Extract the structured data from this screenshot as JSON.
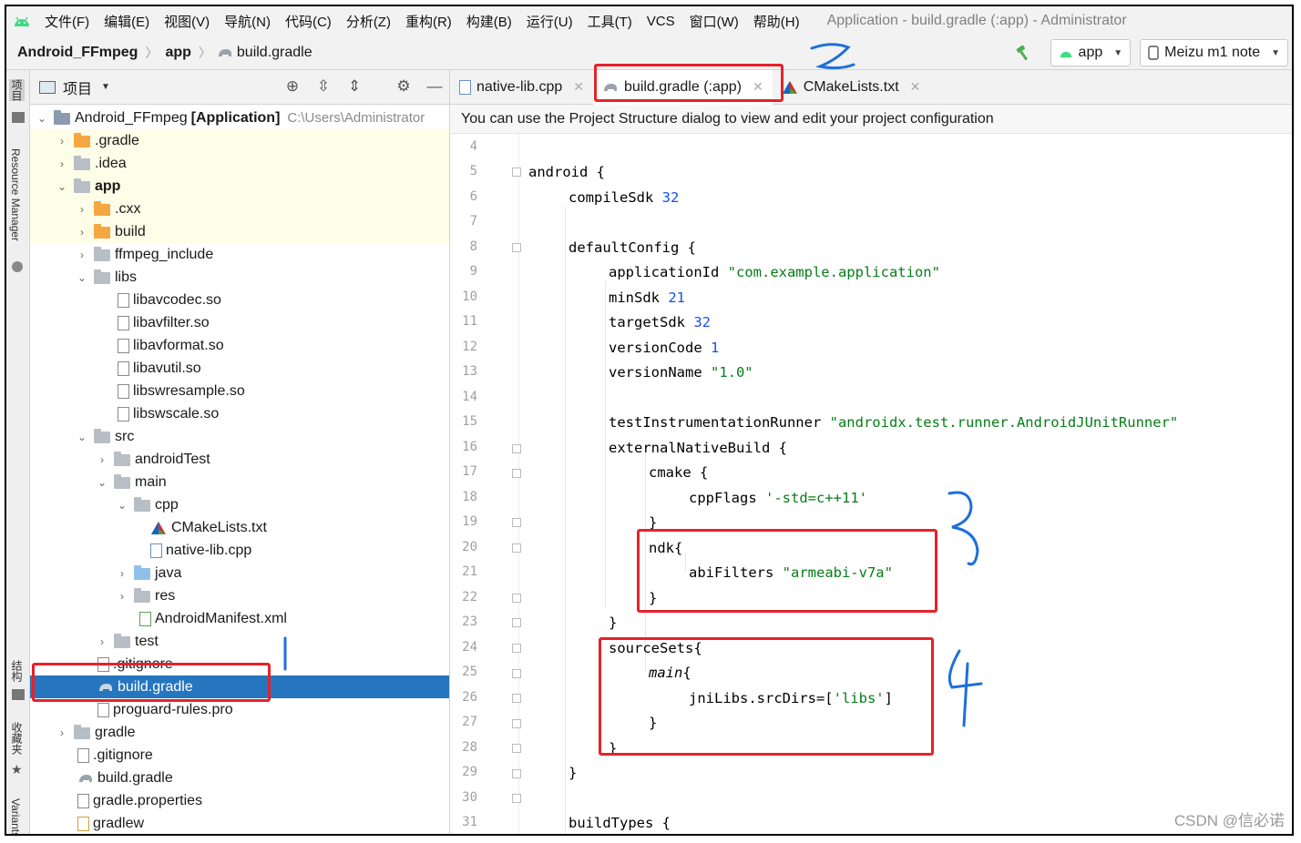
{
  "menu": {
    "items": [
      "文件(F)",
      "编辑(E)",
      "视图(V)",
      "导航(N)",
      "代码(C)",
      "分析(Z)",
      "重构(R)",
      "构建(B)",
      "运行(U)",
      "工具(T)",
      "VCS",
      "窗口(W)",
      "帮助(H)"
    ],
    "window_title": "Application - build.gradle (:app) - Administrator"
  },
  "navbar": {
    "project": "Android_FFmpeg",
    "module": "app",
    "file": "build.gradle",
    "run_config": "app",
    "device": "Meizu m1 note"
  },
  "leftstrip": {
    "project_tab": "项目",
    "resource_manager": "Resource Manager",
    "structure": "结构",
    "favorites": "收藏夹",
    "variants": "Variants"
  },
  "project_panel": {
    "header": "项目",
    "root_name": "Android_FFmpeg",
    "root_tag": "[Application]",
    "root_path": "C:\\Users\\Administrator",
    "items": {
      "gradle_dir": ".gradle",
      "idea": ".idea",
      "app": "app",
      "cxx": ".cxx",
      "build": "build",
      "ffmpeg_include": "ffmpeg_include",
      "libs": "libs",
      "libavcodec": "libavcodec.so",
      "libavfilter": "libavfilter.so",
      "libavformat": "libavformat.so",
      "libavutil": "libavutil.so",
      "libswresample": "libswresample.so",
      "libswscale": "libswscale.so",
      "src": "src",
      "androidTest": "androidTest",
      "main": "main",
      "cpp": "cpp",
      "cmakelists": "CMakeLists.txt",
      "nativelib": "native-lib.cpp",
      "java": "java",
      "res": "res",
      "manifest": "AndroidManifest.xml",
      "test": "test",
      "app_gitignore": ".gitignore",
      "app_buildgradle": "build.gradle",
      "proguard": "proguard-rules.pro",
      "gradle": "gradle",
      "root_gitignore": ".gitignore",
      "root_buildgradle": "build.gradle",
      "gradle_properties": "gradle.properties",
      "gradlew": "gradlew"
    }
  },
  "editor": {
    "tabs": [
      "native-lib.cpp",
      "build.gradle (:app)",
      "CMakeLists.txt"
    ],
    "banner": "You can use the Project Structure dialog to view and edit your project configuration",
    "line_numbers": [
      "4",
      "5",
      "6",
      "7",
      "8",
      "9",
      "10",
      "11",
      "12",
      "13",
      "14",
      "15",
      "16",
      "17",
      "18",
      "19",
      "20",
      "21",
      "22",
      "23",
      "24",
      "25",
      "26",
      "27",
      "28",
      "29",
      "30",
      "31"
    ],
    "code": {
      "l5": "android {",
      "l6a": "compileSdk ",
      "l6b": "32",
      "l8": "defaultConfig {",
      "l9a": "applicationId ",
      "l9b": "\"com.example.application\"",
      "l10a": "minSdk ",
      "l10b": "21",
      "l11a": "targetSdk ",
      "l11b": "32",
      "l12a": "versionCode ",
      "l12b": "1",
      "l13a": "versionName ",
      "l13b": "\"1.0\"",
      "l15a": "testInstrumentationRunner ",
      "l15b": "\"androidx.test.runner.AndroidJUnitRunner\"",
      "l16": "externalNativeBuild {",
      "l17": "cmake {",
      "l18a": "cppFlags ",
      "l18b": "'-std=c++11'",
      "l19": "}",
      "l20": "ndk{",
      "l21a": "abiFilters ",
      "l21b": "\"armeabi-v7a\"",
      "l22": "}",
      "l23": "}",
      "l24": "sourceSets{",
      "l25a": "main",
      "l25b": "{",
      "l26a": "jniLibs.srcDirs=[",
      "l26b": "'libs'",
      "l26c": "]",
      "l27": "}",
      "l28": "}",
      "l29": "}",
      "l31": "buildTypes {"
    }
  },
  "annotations": [
    "1",
    "2",
    "3",
    "4"
  ],
  "watermark": "CSDN @信必诺",
  "colors": {
    "selection": "#2675bf",
    "highlight_row": "#fefde7",
    "string": "#067d17",
    "number": "#1750eb",
    "annotation_red": "#e5222a",
    "annotation_blue": "#1e6fd9"
  }
}
